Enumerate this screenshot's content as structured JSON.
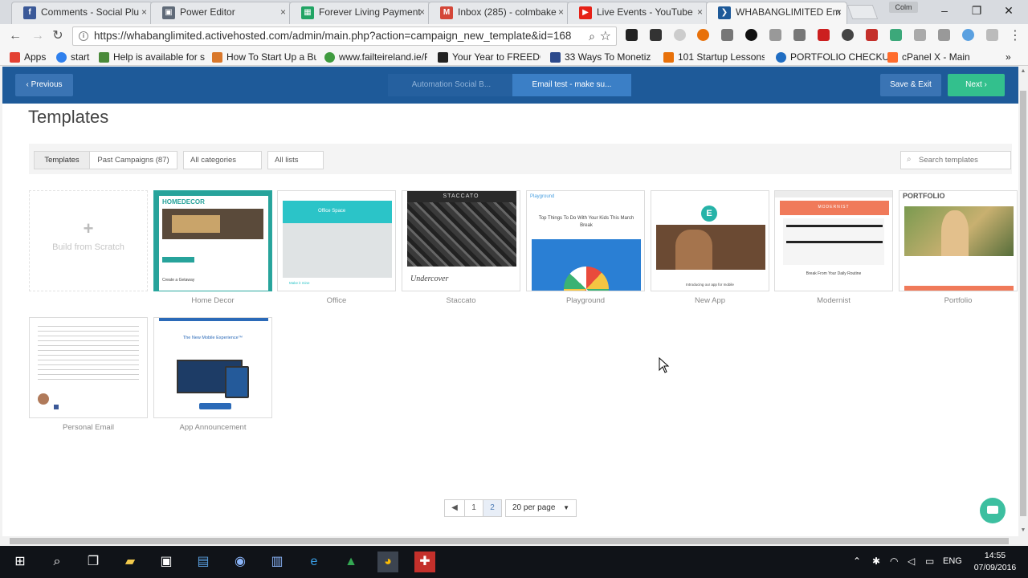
{
  "browser": {
    "tabs": [
      {
        "title": "Comments - Social Plu",
        "close": "×",
        "fav": "f",
        "color": "#3b5998"
      },
      {
        "title": "Power Editor",
        "close": "×",
        "fav": "▣",
        "color": "#5f6a78"
      },
      {
        "title": "Forever Living Payment",
        "close": "×",
        "fav": "▦",
        "color": "#21a464"
      },
      {
        "title": "Inbox (285) - colmbake",
        "close": "×",
        "fav": "M",
        "color": "#d44638"
      },
      {
        "title": "Live Events - YouTube",
        "close": "×",
        "fav": "▶",
        "color": "#e62117"
      },
      {
        "title": "WHABANGLIMITED Em",
        "close": "×",
        "fav": "❯",
        "color": "#1e5a99"
      }
    ],
    "profile": "Colm",
    "url": "https://whabanglimited.activehosted.com/admin/main.php?action=campaign_new_template&id=168",
    "bookmarks": [
      {
        "label": "Apps",
        "color": "#e34133"
      },
      {
        "label": "start",
        "color": "#2f80ed"
      },
      {
        "label": "Help is available for st",
        "color": "#4a8a3a"
      },
      {
        "label": "How To Start Up a Bus",
        "color": "#d9782b"
      },
      {
        "label": "www.failteireland.ie/F",
        "color": "#3f9b3f"
      },
      {
        "label": "Your Year to FREEDOM",
        "color": "#222222"
      },
      {
        "label": "33 Ways To Monetize",
        "color": "#2c4a8c"
      },
      {
        "label": "101 Startup Lessons--",
        "color": "#e8710a"
      },
      {
        "label": "PORTFOLIO CHECKUP",
        "color": "#1f6dc2"
      },
      {
        "label": "cPanel X - Main",
        "color": "#ff6c2c"
      }
    ],
    "more": "»"
  },
  "header": {
    "previous": "‹  Previous",
    "steps": [
      "Automation Social B...",
      "Email test - make su..."
    ],
    "save_exit": "Save & Exit",
    "next": "Next   ›"
  },
  "main": {
    "title": "Templates",
    "filters": {
      "tab_templates": "Templates",
      "tab_past": "Past Campaigns (87)",
      "categories": "All categories",
      "lists": "All lists",
      "search_placeholder": "Search templates"
    },
    "scratch": {
      "plus": "+",
      "label": "Build from Scratch"
    },
    "templates": [
      {
        "name": "Home Decor"
      },
      {
        "name": "Office"
      },
      {
        "name": "Staccato"
      },
      {
        "name": "Playground"
      },
      {
        "name": "New App"
      },
      {
        "name": "Modernist"
      },
      {
        "name": "Portfolio"
      },
      {
        "name": "Personal Email"
      },
      {
        "name": "App Announcement"
      }
    ],
    "thumb_text": {
      "home_decor": "HOMEDECOR",
      "home_decor_sub": "Create a Getaway",
      "office_logo": "Office Space",
      "office_line": "Make it mine",
      "staccato_logo": "STACCATO",
      "staccato_title": "Undercover",
      "playground_logo": "Playground",
      "playground_head": "Top Things To Do With Your Kids This March Break",
      "newapp_logo": "E",
      "newapp_text": "Introducing our app for mobile",
      "modernist_banner": "MODERNIST",
      "modernist_text": "Break From Your Daily Routine",
      "portfolio_title": "PORTFOLIO",
      "appann_title": "The New Mobile Experience™"
    }
  },
  "pagination": {
    "prev": "◀",
    "pages": [
      "1",
      "2"
    ],
    "per_page": "20 per page",
    "caret": "▼"
  },
  "taskbar": {
    "start": "⊞",
    "lang": "ENG",
    "time": "14:55",
    "date": "07/09/2016"
  }
}
